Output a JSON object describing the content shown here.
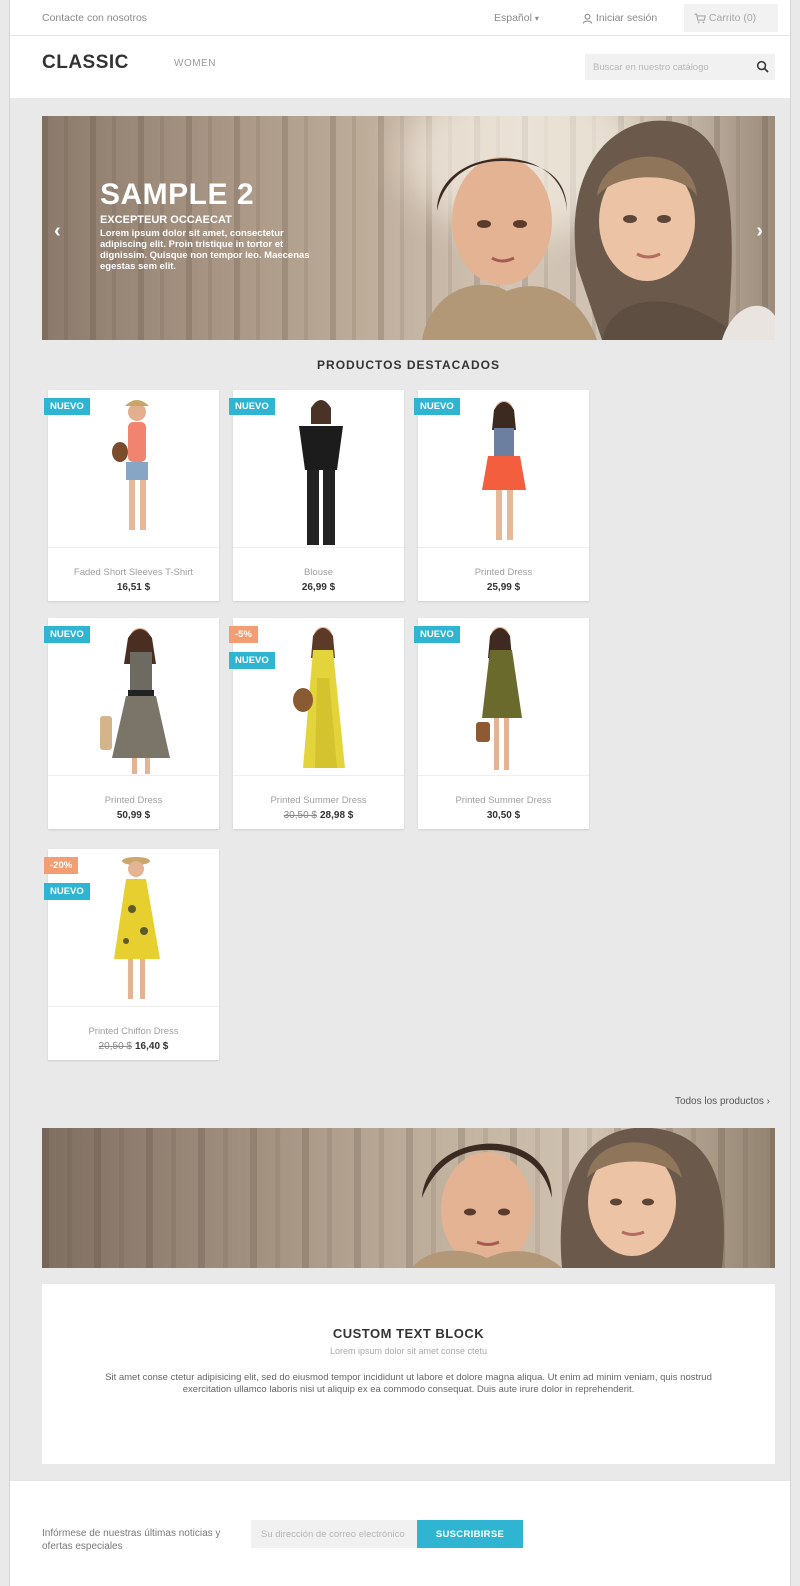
{
  "topnav": {
    "contact": "Contacte con nosotros",
    "language": "Español",
    "signin": "Iniciar sesión",
    "cart": "Carrito (0)"
  },
  "header": {
    "logo": "CLASSIC",
    "menu": [
      "WOMEN"
    ],
    "search_placeholder": "Buscar en nuestro catálogo"
  },
  "slider": {
    "title": "SAMPLE 2",
    "subtitle": "EXCEPTEUR OCCAECAT",
    "text": "Lorem ipsum dolor sit amet, consectetur adipiscing elit. Proin tristique in tortor et dignissim. Quisque non tempor leo. Maecenas egestas sem elit.",
    "arrow_left": "‹",
    "arrow_right": "›"
  },
  "featured": {
    "title": "PRODUCTOS DESTACADOS",
    "products": [
      {
        "name": "Faded Short Sleeves T-Shirt",
        "price": "16,51 $",
        "old_price": "",
        "flags": [
          "NUEVO"
        ]
      },
      {
        "name": "Blouse",
        "price": "26,99 $",
        "old_price": "",
        "flags": [
          "NUEVO"
        ]
      },
      {
        "name": "Printed Dress",
        "price": "25,99 $",
        "old_price": "",
        "flags": [
          "NUEVO"
        ]
      },
      {
        "name": "Printed Dress",
        "price": "50,99 $",
        "old_price": "",
        "flags": [
          "NUEVO"
        ]
      },
      {
        "name": "Printed Summer Dress",
        "price": "28,98 $",
        "old_price": "30,50 $",
        "flags": [
          "-5%",
          "NUEVO"
        ]
      },
      {
        "name": "Printed Summer Dress",
        "price": "30,50 $",
        "old_price": "",
        "flags": [
          "NUEVO"
        ]
      },
      {
        "name": "Printed Chiffon Dress",
        "price": "16,40 $",
        "old_price": "20,50 $",
        "flags": [
          "-20%",
          "NUEVO"
        ]
      }
    ],
    "all_products_link": "Todos los productos ›"
  },
  "custom_block": {
    "title": "CUSTOM TEXT BLOCK",
    "subtitle": "Lorem ipsum dolor sit amet conse ctetu",
    "text": "Sit amet conse ctetur adipisicing elit, sed do eiusmod tempor incididunt ut labore et dolore magna aliqua. Ut enim ad minim veniam, quis nostrud exercitation ullamco laboris nisi ut aliquip ex ea commodo consequat. Duis aute irure dolor in reprehenderit."
  },
  "newsletter": {
    "text": "Infórmese de nuestras últimas noticias y ofertas especiales",
    "placeholder": "Su dirección de correo electrónico",
    "button": "SUSCRIBIRSE"
  },
  "colors": {
    "accent": "#2fb5d2",
    "discount": "#f39d72",
    "background": "#e9e9e9"
  }
}
